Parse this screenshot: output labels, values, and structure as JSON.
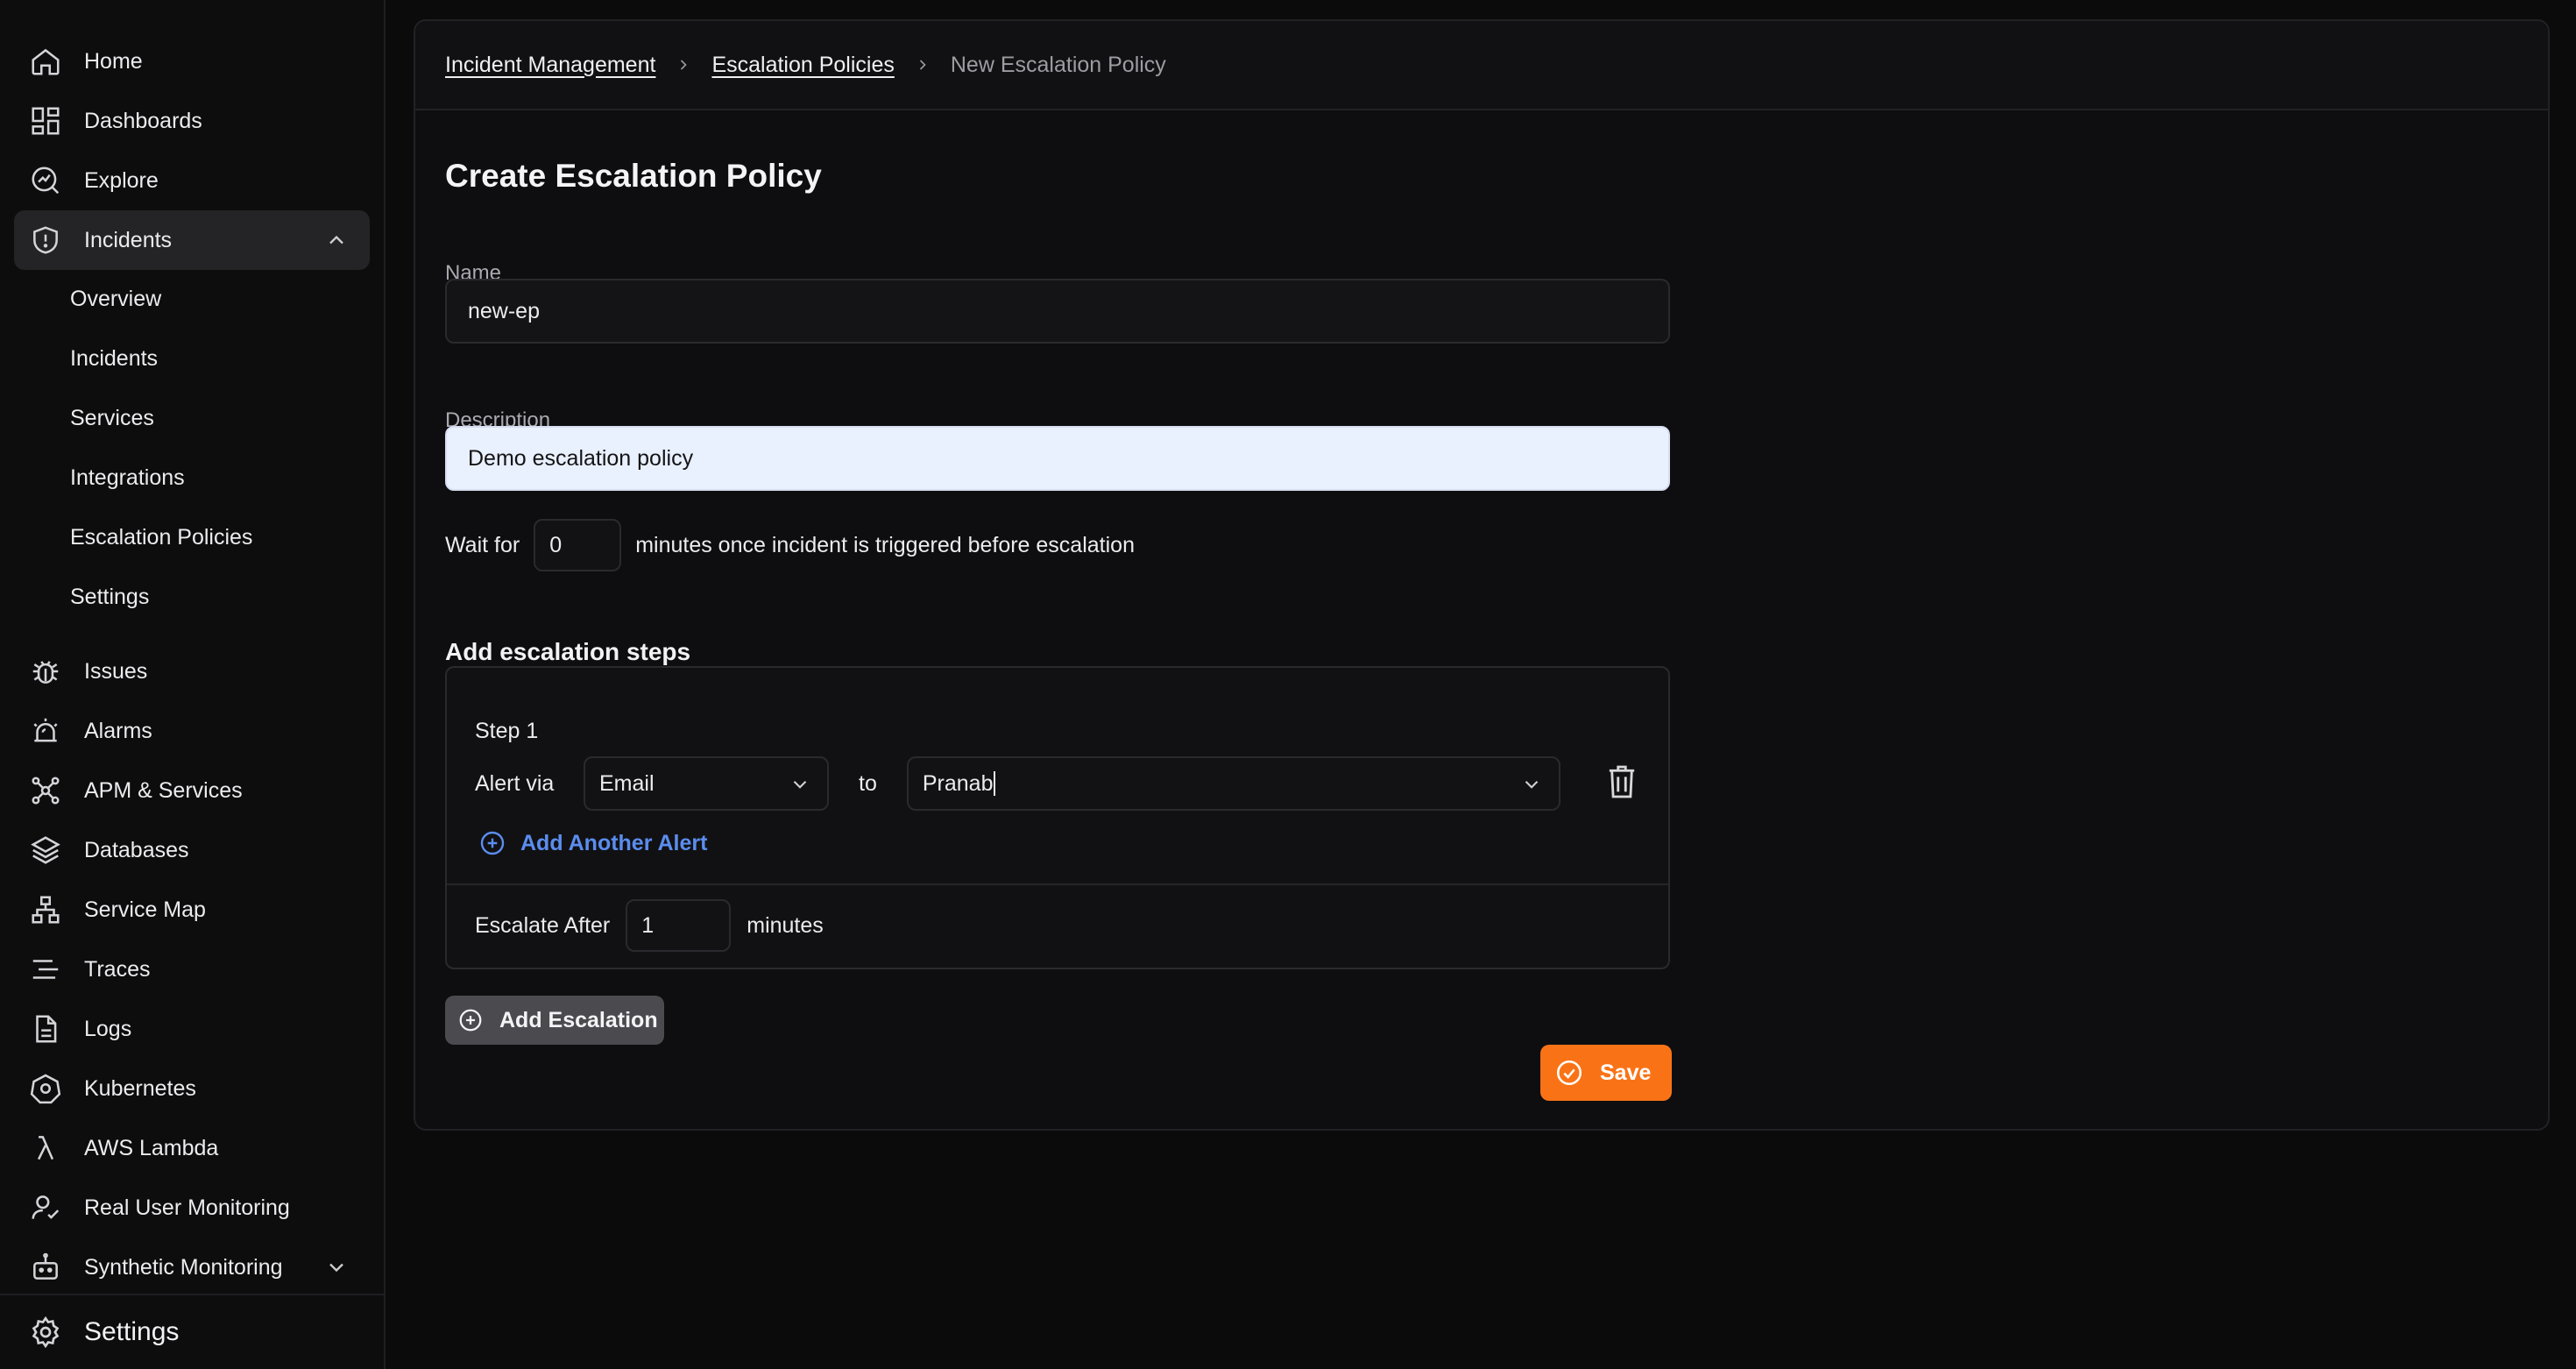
{
  "sidebar": {
    "top_items": [
      {
        "label": "Home",
        "icon": "home-icon"
      },
      {
        "label": "Dashboards",
        "icon": "dashboard-icon"
      },
      {
        "label": "Explore",
        "icon": "explore-icon"
      },
      {
        "label": "Incidents",
        "icon": "shield-alert-icon"
      }
    ],
    "incident_subitems": [
      {
        "label": "Overview"
      },
      {
        "label": "Incidents"
      },
      {
        "label": "Services"
      },
      {
        "label": "Integrations"
      },
      {
        "label": "Escalation Policies"
      },
      {
        "label": "Settings"
      }
    ],
    "lower_items": [
      {
        "label": "Issues",
        "icon": "bug-icon"
      },
      {
        "label": "Alarms",
        "icon": "alarm-icon"
      },
      {
        "label": "APM & Services",
        "icon": "network-icon"
      },
      {
        "label": "Databases",
        "icon": "layers-icon"
      },
      {
        "label": "Service Map",
        "icon": "service-map-icon"
      },
      {
        "label": "Traces",
        "icon": "traces-icon"
      },
      {
        "label": "Logs",
        "icon": "file-icon"
      },
      {
        "label": "Kubernetes",
        "icon": "kubernetes-icon"
      },
      {
        "label": "AWS Lambda",
        "icon": "lambda-icon"
      },
      {
        "label": "Real User Monitoring",
        "icon": "user-monitor-icon"
      },
      {
        "label": "Synthetic Monitoring",
        "icon": "robot-icon"
      }
    ],
    "footer_label": "Settings"
  },
  "breadcrumb": {
    "items": [
      "Incident Management",
      "Escalation Policies"
    ],
    "current": "New Escalation Policy"
  },
  "page": {
    "title": "Create Escalation Policy"
  },
  "form": {
    "name_label": "Name",
    "name_value": "new-ep",
    "description_label": "Description",
    "description_value": "Demo escalation policy",
    "wait_prefix": "Wait for",
    "wait_value": "0",
    "wait_suffix": "minutes once incident is triggered before escalation",
    "steps_title": "Add escalation steps"
  },
  "step": {
    "label": "Step 1",
    "alert_via_label": "Alert via",
    "alert_method": "Email",
    "to_label": "to",
    "recipient": "Pranab",
    "add_alert_label": "Add Another Alert",
    "escalate_after_label": "Escalate After",
    "escalate_after_value": "1",
    "escalate_after_unit": "minutes"
  },
  "actions": {
    "add_escalation_label": "Add Escalation",
    "save_label": "Save"
  },
  "colors": {
    "accent_save": "#f97316",
    "link_blue": "#5b8def",
    "highlight_input": "#e9f0fe"
  }
}
